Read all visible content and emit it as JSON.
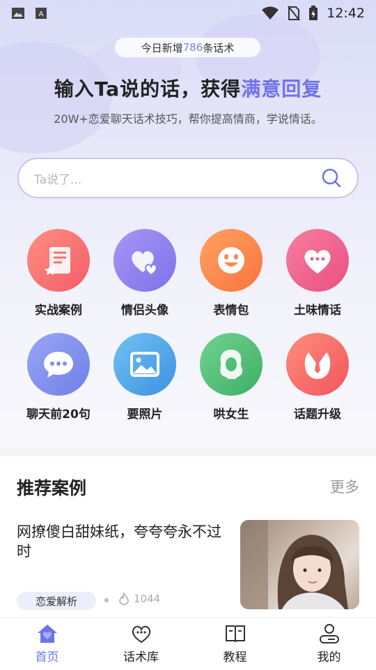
{
  "status_bar": {
    "time": "12:42"
  },
  "hero": {
    "badge": {
      "prefix": "今日新增",
      "count": "786",
      "suffix": "条话术"
    },
    "headline": {
      "main": "输入Ta说的话，获得",
      "highlight": "满意回复"
    },
    "subline": "20W+恋爱聊天话术技巧，帮你提高情商，学说情话。"
  },
  "search": {
    "placeholder": "Ta说了..."
  },
  "features": [
    {
      "label": "实战案例",
      "icon": "case-book-icon",
      "color": "#f46f6a"
    },
    {
      "label": "情侣头像",
      "icon": "double-heart-icon",
      "color": "#8d7ff0"
    },
    {
      "label": "表情包",
      "icon": "smiley-icon",
      "color": "#fb8a4c"
    },
    {
      "label": "土味情话",
      "icon": "heart-chat-icon",
      "color": "#f15e8a"
    },
    {
      "label": "聊天前20句",
      "icon": "chat-bubble-icon",
      "color": "#7f8ff0"
    },
    {
      "label": "要照片",
      "icon": "picture-icon",
      "color": "#4aa6e8"
    },
    {
      "label": "哄女生",
      "icon": "girl-icon",
      "color": "#4fbf77"
    },
    {
      "label": "话题升级",
      "icon": "suit-tie-icon",
      "color": "#f5706a"
    }
  ],
  "recommend": {
    "title": "推荐案例",
    "more": "更多",
    "card": {
      "title": "网撩傻白甜妹纸，夸夸夸永不过时",
      "tag": "恋爱解析",
      "views": "1044"
    }
  },
  "tabs": [
    {
      "label": "首页",
      "icon": "home-icon",
      "active": true
    },
    {
      "label": "话术库",
      "icon": "heart-chat-icon",
      "active": false
    },
    {
      "label": "教程",
      "icon": "book-icon",
      "active": false
    },
    {
      "label": "我的",
      "icon": "profile-icon",
      "active": false
    }
  ],
  "colors": {
    "accent": "#6f73e6"
  }
}
